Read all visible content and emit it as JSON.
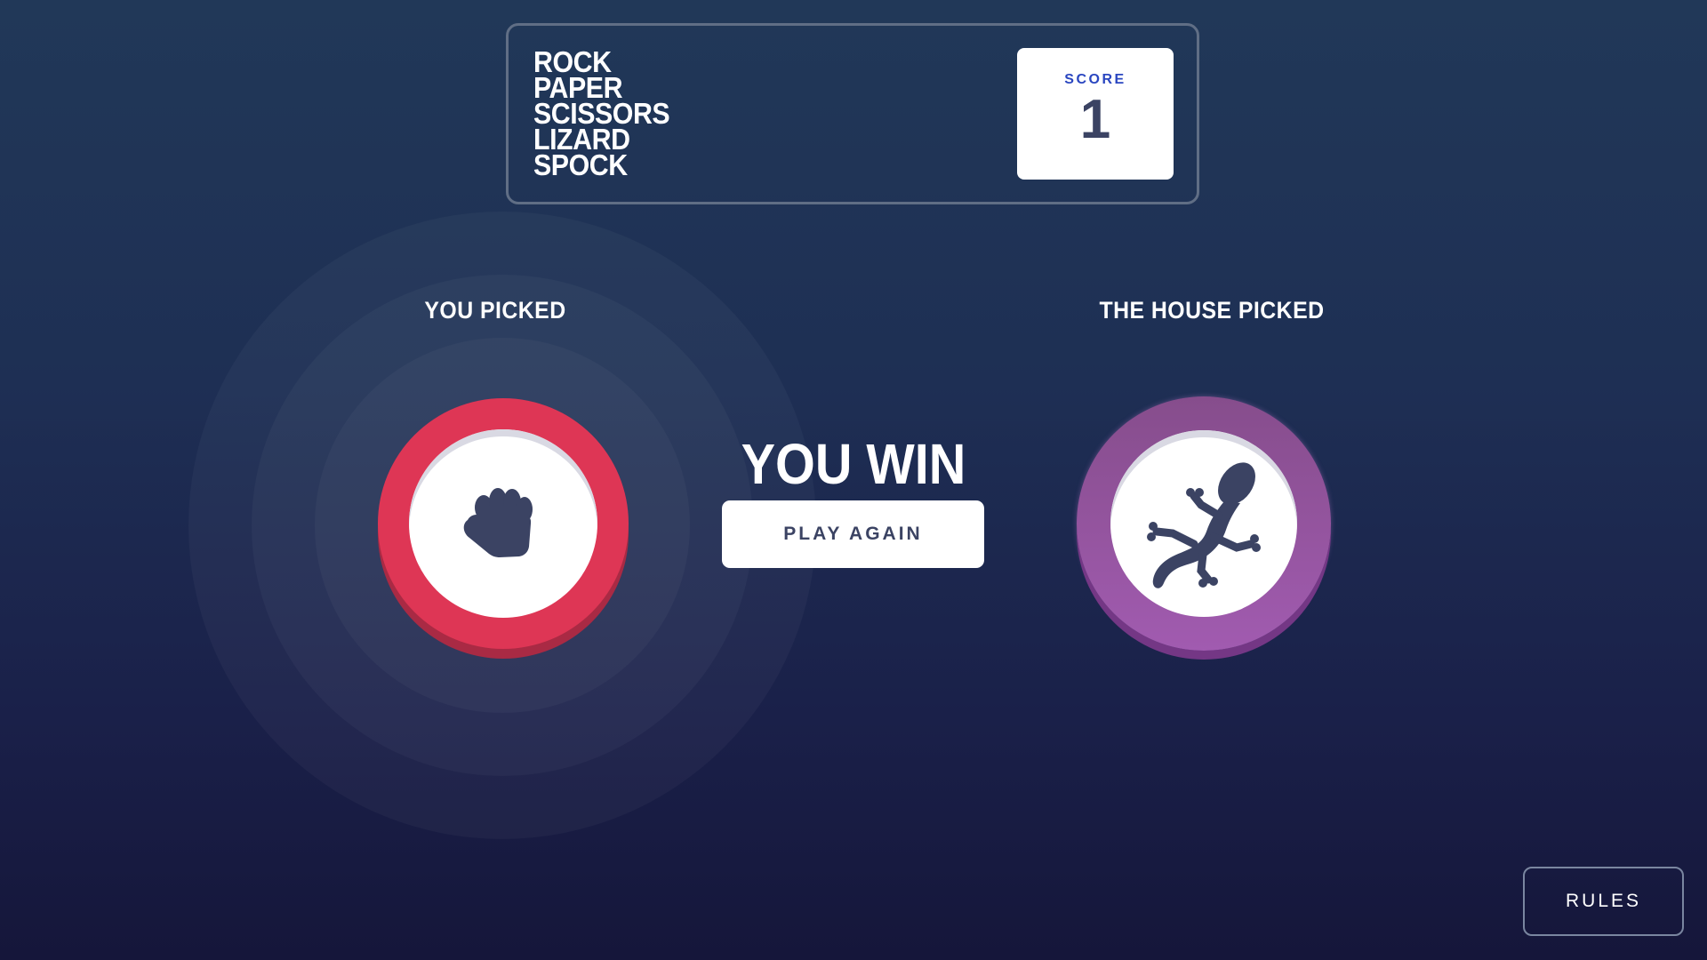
{
  "header": {
    "title_lines": [
      "ROCK",
      "PAPER",
      "SCISSORS",
      "LIZARD",
      "SPOCK"
    ],
    "score_label": "SCORE",
    "score_value": "1"
  },
  "player": {
    "label": "YOU PICKED",
    "choice": "rock",
    "icon": "fist-icon",
    "ring_color": "#de3655"
  },
  "house": {
    "label": "THE HOUSE PICKED",
    "choice": "lizard",
    "icon": "lizard-icon",
    "ring_color": "#9b56a8"
  },
  "result": {
    "text": "YOU WIN",
    "button_label": "PLAY AGAIN"
  },
  "footer": {
    "rules_label": "RULES"
  },
  "colors": {
    "text_dark": "#3b4363",
    "score_label": "#2a46c0",
    "background_top": "#213858",
    "background_bottom": "#15163a"
  }
}
